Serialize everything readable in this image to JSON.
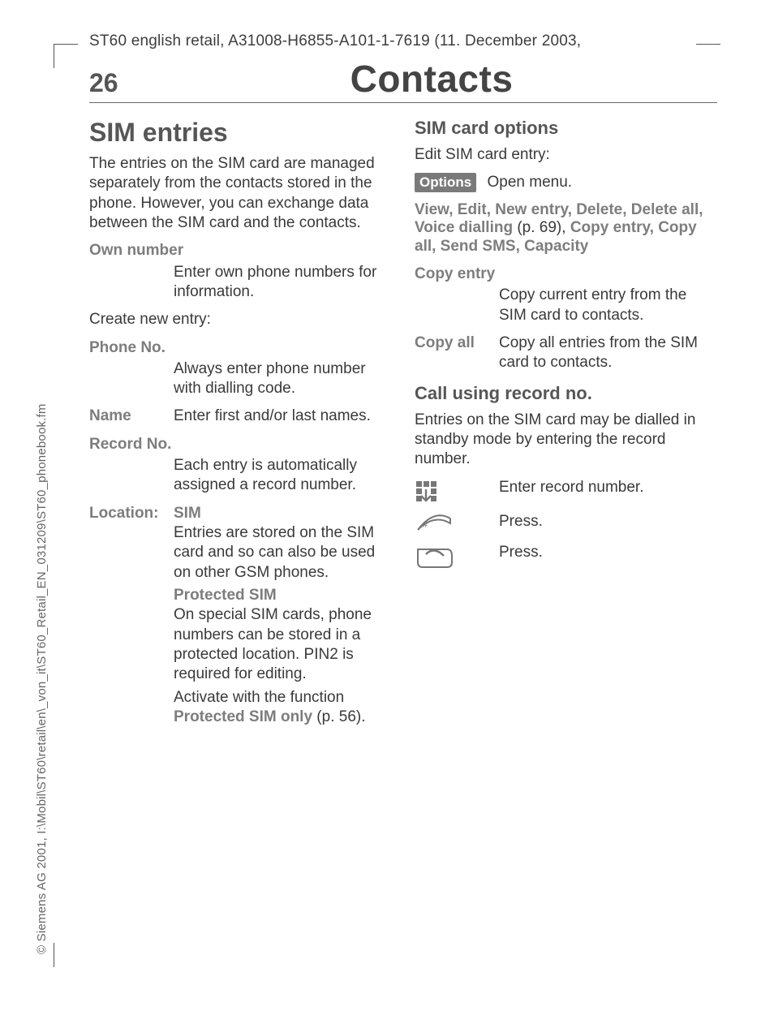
{
  "doc_header": "ST60 english retail, A31008-H6855-A101-1-7619 (11. December 2003,",
  "page_number": "26",
  "page_title": "Contacts",
  "sidebar": "© Siemens AG 2001, I:\\Mobil\\ST60\\retail\\en\\_von_it\\ST60_Retail_EN_031209\\ST60_phonebook.fm",
  "left": {
    "h1": "SIM entries",
    "intro": "The entries on the SIM card are managed separately from the contacts stored in the phone. However, you can exchange data between the SIM card and the contacts.",
    "own_number_label": "Own number",
    "own_number_text": "Enter own phone numbers for information.",
    "create_new": "Create new entry:",
    "phone_no_label": "Phone No.",
    "phone_no_text": "Always enter phone number with dialling code.",
    "name_label": "Name",
    "name_text": "Enter first and/or last names.",
    "record_no_label": "Record No.",
    "record_no_text": "Each entry is automatically assigned a record number.",
    "location_label": "Location:",
    "location_value": "SIM",
    "location_text": "Entries are stored on the SIM card and so can also be used on other GSM phones.",
    "protected_sim_label": "Protected SIM",
    "protected_sim_text": "On special SIM cards, phone numbers can be stored in a protected location. PIN2 is required for editing.",
    "activate_pre": "Activate with the function ",
    "activate_label": "Protected SIM only",
    "activate_post": " (p. 56)."
  },
  "right": {
    "h2a": "SIM card options",
    "edit_entry": "Edit SIM card entry:",
    "options_badge": "Options",
    "open_menu": "Open menu.",
    "menu_line1": "View, Edit, New entry, Delete, Delete all, Voice dialling",
    "menu_mid": " (p. 69), ",
    "menu_line2": "Copy entry, Copy all, Send SMS, Capacity",
    "copy_entry_label": "Copy entry",
    "copy_entry_text": "Copy current entry from the SIM card to contacts.",
    "copy_all_label": "Copy all",
    "copy_all_text": "Copy all entries from the SIM card to contacts.",
    "h2b": "Call using record no.",
    "call_intro": "Entries on the SIM card may be dialled in standby mode by entering the record number.",
    "enter_record": "Enter record number.",
    "press1": "Press.",
    "press2": "Press."
  }
}
